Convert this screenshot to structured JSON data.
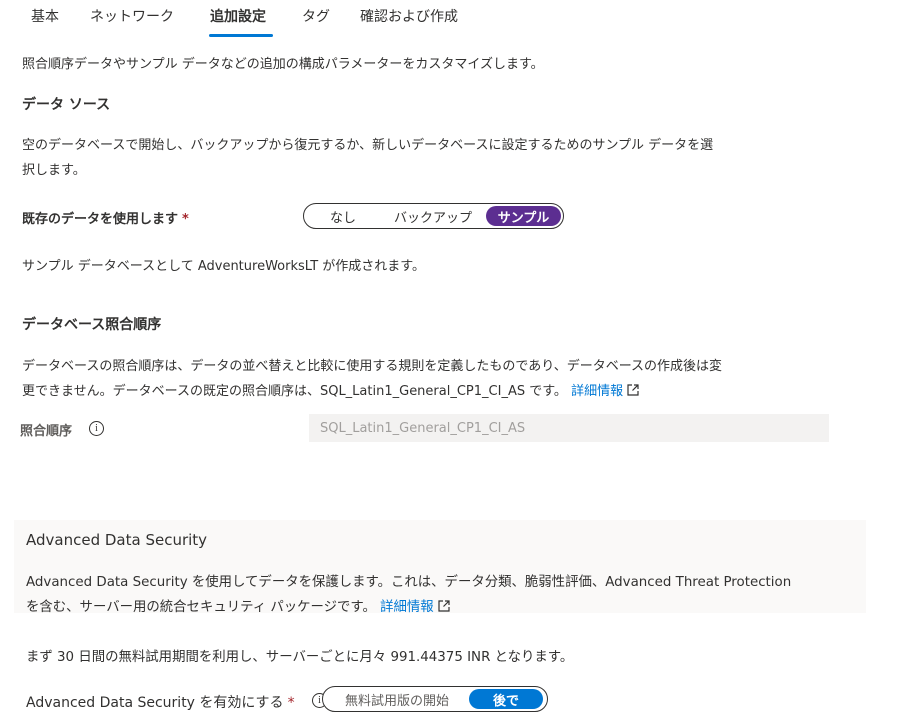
{
  "tabs": [
    {
      "label": "基本",
      "active": false
    },
    {
      "label": "ネットワーク",
      "active": false
    },
    {
      "label": "追加設定",
      "active": true
    },
    {
      "label": "タグ",
      "active": false
    },
    {
      "label": "確認および作成",
      "active": false
    }
  ],
  "intro": "照合順序データやサンプル データなどの追加の構成パラメーターをカスタマイズします。",
  "data_source": {
    "heading": "データ ソース",
    "desc_line1": "空のデータベースで開始し、バックアップから復元するか、新しいデータベースに設定するためのサンプル データを選",
    "desc_line2": "択します。",
    "use_existing_label": "既存のデータを使用します",
    "required_mark": "*",
    "options": [
      "なし",
      "バックアップ",
      "サンプル"
    ],
    "selected": "サンプル",
    "note": "サンプル データベースとして AdventureWorksLT が作成されます。"
  },
  "collation": {
    "heading": "データベース照合順序",
    "desc_line1": "データベースの照合順序は、データの並べ替えと比較に使用する規則を定義したものであり、データベースの作成後は変",
    "desc_line2": "更できません。データベースの既定の照合順序は、SQL_Latin1_General_CP1_CI_AS です。",
    "learn_more": "詳細情報",
    "field_label": "照合順序",
    "field_value": "SQL_Latin1_General_CP1_CI_AS"
  },
  "ads": {
    "heading": "Advanced Data Security",
    "desc_line1": "Advanced Data Security を使用してデータを保護します。これは、データ分類、脆弱性評価、Advanced Threat Protection",
    "desc_line2": "を含む、サーバー用の統合セキュリティ パッケージです。",
    "learn_more": "詳細情報",
    "trial_note": "まず 30 日間の無料試用期間を利用し、サーバーごとに月々 991.44375 INR となります。",
    "enable_label": "Advanced Data Security を有効にする",
    "required_mark": "*",
    "options": [
      "無料試用版の開始",
      "後で"
    ],
    "selected": "後で"
  },
  "colors": {
    "accent": "#0078d4",
    "selected_purple": "#5c2e91",
    "required": "#a4262c"
  },
  "icons": {
    "external_link": "external-link-icon",
    "info": "info-icon"
  }
}
